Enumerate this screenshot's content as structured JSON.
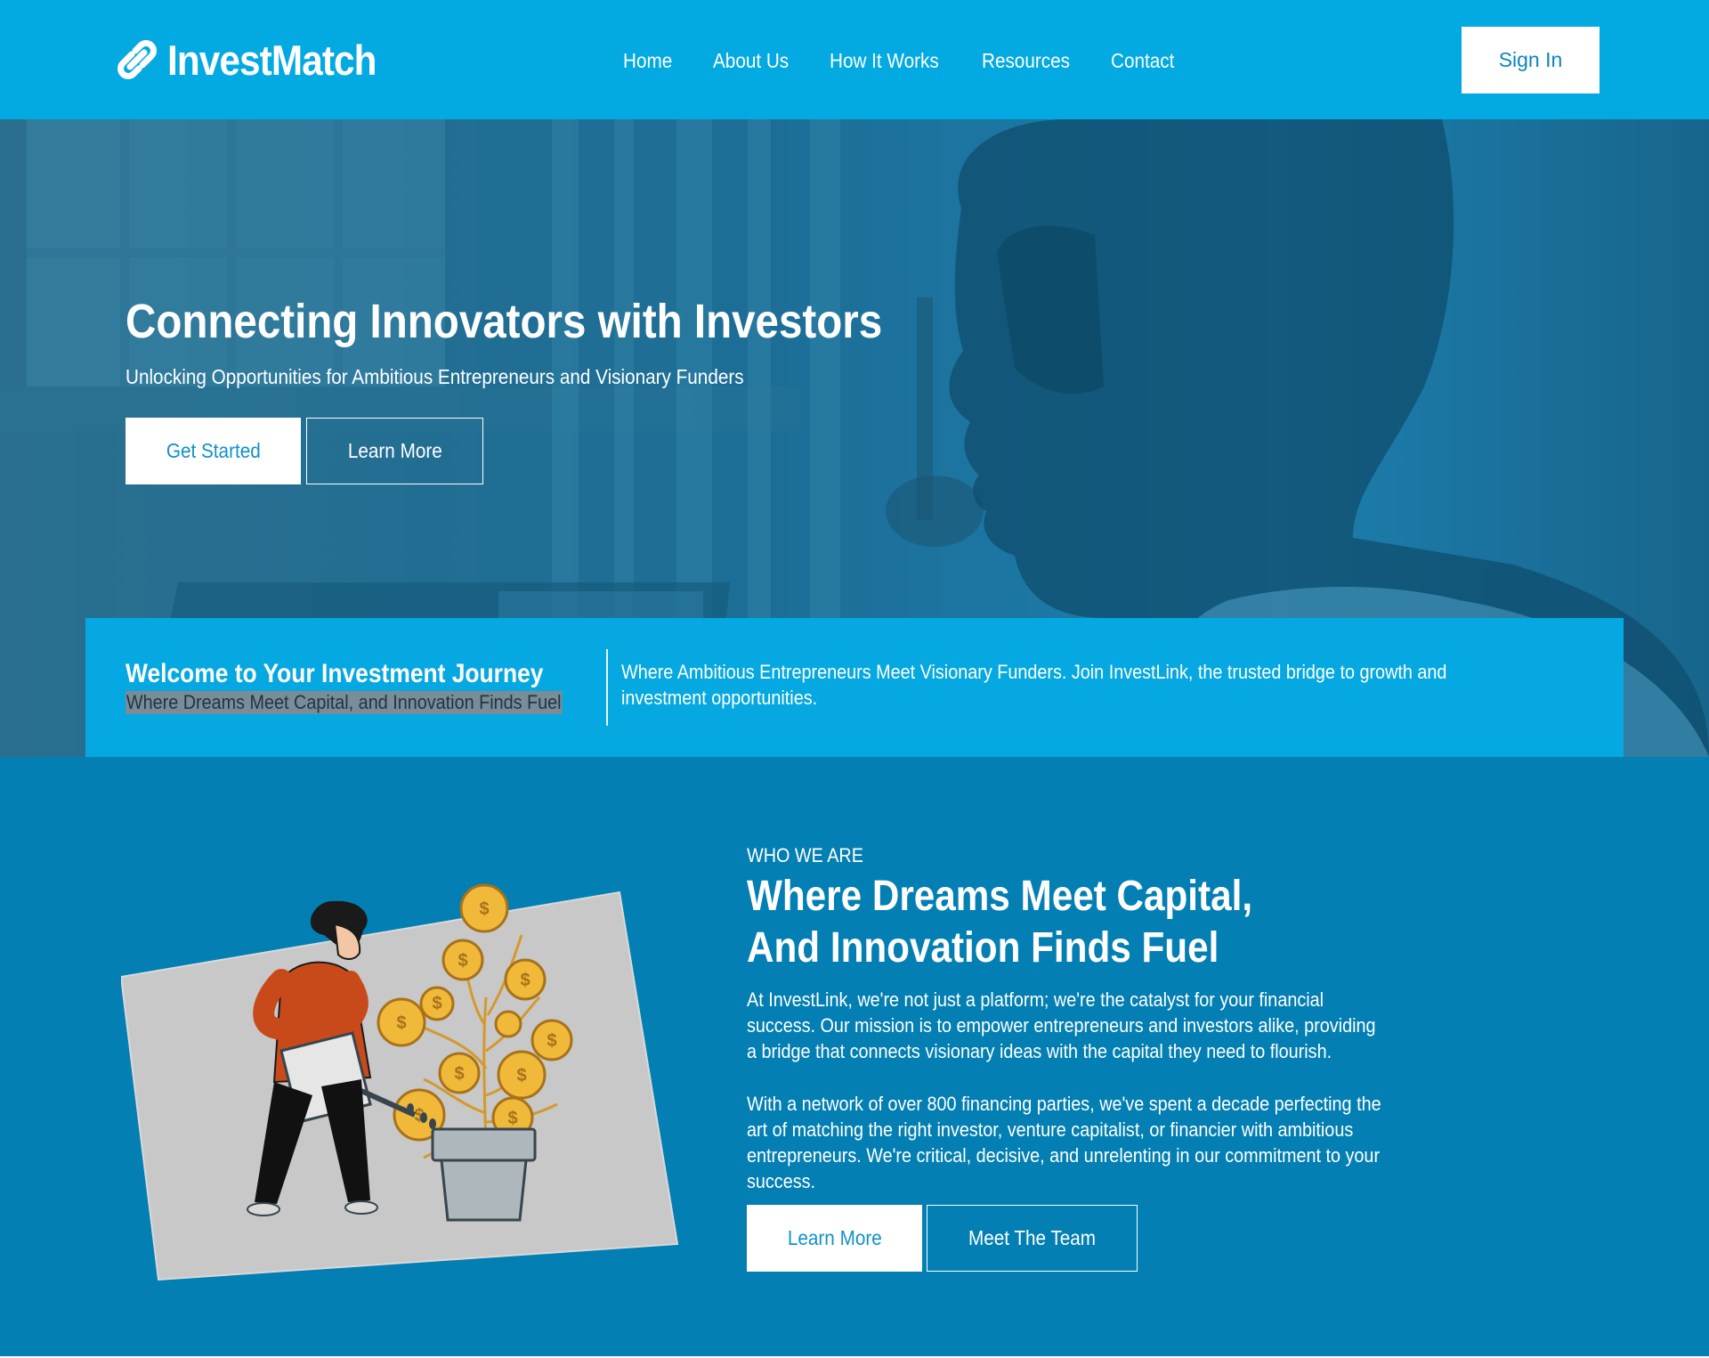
{
  "colors": {
    "header_bg": "#03a9e1",
    "band_bg": "#05a8e0",
    "about_bg": "#037fb3",
    "accent_text": "#1191c8"
  },
  "header": {
    "logo_icon": "chain-link-icon",
    "logo_text": "InvestMatch",
    "nav": [
      "Home",
      "About Us",
      "How It Works",
      "Resources",
      "Contact"
    ],
    "signin_label": "Sign In"
  },
  "hero": {
    "title": "Connecting Innovators with Investors",
    "subtitle": "Unlocking Opportunities for Ambitious Entrepreneurs and Visionary Funders",
    "primary_button": "Get Started",
    "secondary_button": "Learn More"
  },
  "welcome": {
    "title": "Welcome to Your Investment Journey",
    "subtitle": "Where Dreams Meet Capital, and Innovation Finds Fuel",
    "text": "Where Ambitious Entrepreneurs Meet Visionary Funders. Join InvestLink, the trusted bridge to growth and investment opportunities."
  },
  "about": {
    "eyebrow": "WHO WE ARE",
    "title": "Where Dreams Meet Capital, And Innovation Finds Fuel",
    "paragraph1": "At InvestLink, we're not just a platform; we're the catalyst for your financial success. Our mission is to empower entrepreneurs and investors alike, providing a bridge that connects visionary ideas with the capital they need to flourish.",
    "paragraph2": "With a network of over 800 financing parties, we've spent a decade perfecting the art of matching the right investor, venture capitalist, or financier with ambitious entrepreneurs. We're critical, decisive, and unrelenting in our commitment to your success.",
    "primary_button": "Learn More",
    "secondary_button": "Meet The Team",
    "illustration": "money-tree-illustration"
  }
}
